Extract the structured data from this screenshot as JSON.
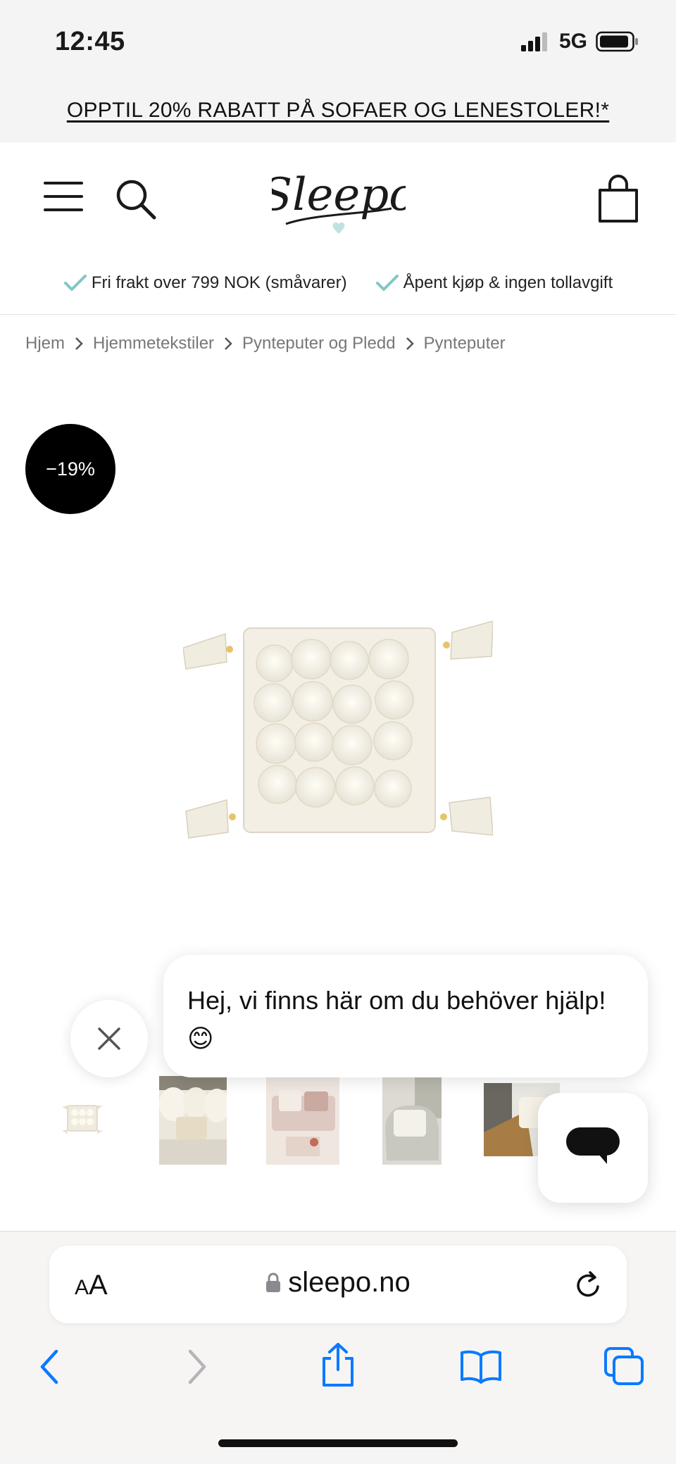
{
  "status_bar": {
    "time": "12:45",
    "network": "5G"
  },
  "promo": {
    "text": "OPPTIL 20% RABATT PÅ SOFAER OG LENESTOLER!*"
  },
  "header": {
    "logo_text": "Sleepo"
  },
  "usp": [
    {
      "text": "Fri frakt over 799 NOK (småvarer)"
    },
    {
      "text": "Åpent kjøp & ingen tollavgift"
    }
  ],
  "breadcrumb": [
    "Hjem",
    "Hjemmetekstiler",
    "Pynteputer og Pledd",
    "Pynteputer"
  ],
  "product": {
    "discount": "−19%"
  },
  "chat": {
    "message": "Hej, vi finns här om du behöver hjälp!😊"
  },
  "safari": {
    "aa_small": "A",
    "aa_big": "A",
    "url": "sleepo.no"
  },
  "colors": {
    "accent_check": "#7fc7c4",
    "ios_blue": "#0a7aff",
    "badge": "#000000"
  }
}
